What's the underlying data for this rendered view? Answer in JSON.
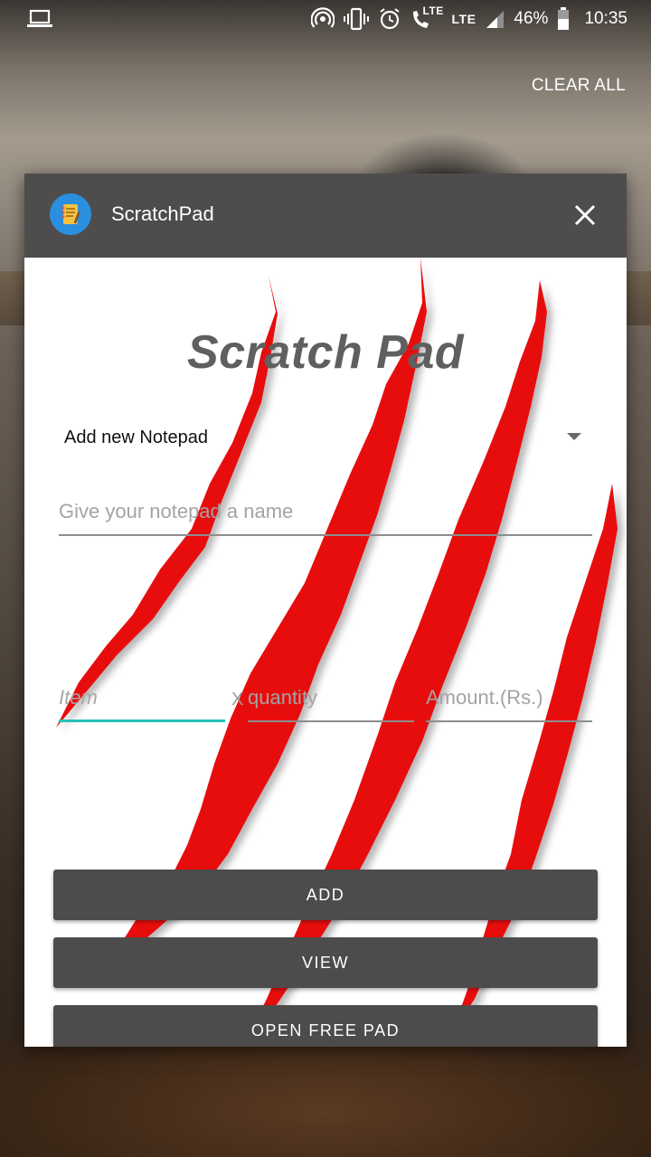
{
  "status_bar": {
    "lte1": "LTE",
    "lte2": "LTE",
    "battery": "46%",
    "time": "10:35",
    "icons": [
      "laptop-icon",
      "hotspot-icon",
      "vibrate-icon",
      "alarm-icon",
      "call-icon",
      "signal-icon",
      "battery-icon"
    ]
  },
  "recents": {
    "clear_all": "CLEAR ALL"
  },
  "app": {
    "name": "ScratchPad",
    "icon": "notepad-icon"
  },
  "screen": {
    "title": "Scratch Pad",
    "dropdown_value": "Add new Notepad",
    "name_placeholder": "Give your notepad a name",
    "item_placeholder": "Item",
    "separator": "X",
    "quantity_placeholder": "quantity",
    "amount_placeholder": "Amount.(Rs.)",
    "buttons": {
      "add": "ADD",
      "view": "VIEW",
      "free_pad": "OPEN FREE PAD"
    }
  },
  "colors": {
    "header": "#4e4c4c",
    "button": "#4d4b4b",
    "accent_underline": "#25c2b8",
    "scratch_red": "#e8070f"
  }
}
